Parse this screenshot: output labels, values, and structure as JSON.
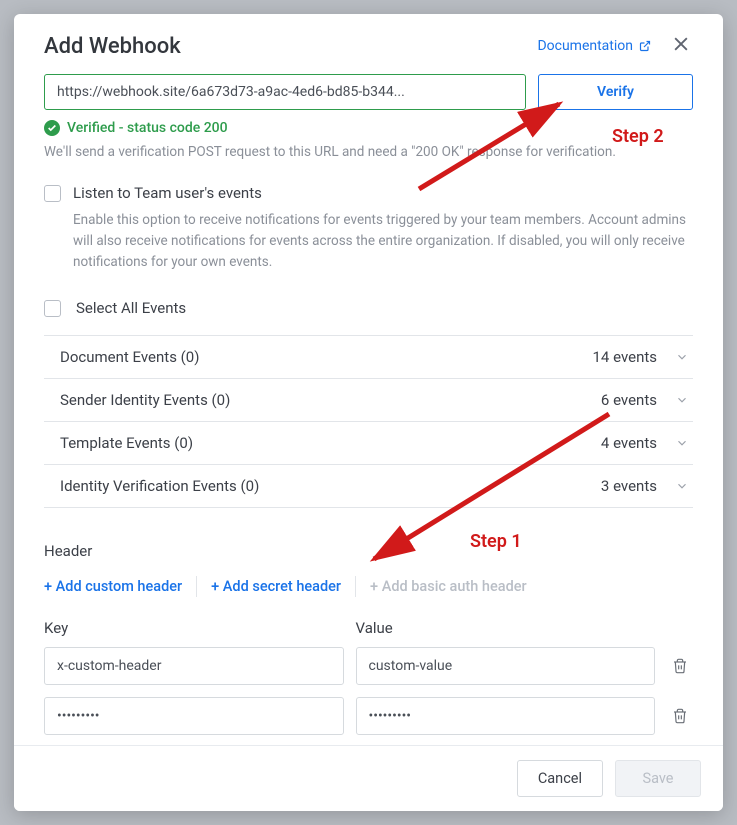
{
  "title": "Add Webhook",
  "documentation_label": "Documentation",
  "url_value": "https://webhook.site/6a673d73-a9ac-4ed6-bd85-b344...",
  "verify_label": "Verify",
  "verified_text": "Verified - status code 200",
  "verify_help": "We'll send a verification POST request to this URL and need a \"200 OK\" response for verification.",
  "team_events": {
    "label": "Listen to Team user's events",
    "desc": "Enable this option to receive notifications for events triggered by your team members. Account admins will also receive notifications for events across the entire organization. If disabled, you will only receive notifications for your own events."
  },
  "select_all_label": "Select All Events",
  "event_categories": [
    {
      "name": "Document Events (0)",
      "count": "14 events"
    },
    {
      "name": "Sender Identity Events (0)",
      "count": "6 events"
    },
    {
      "name": "Template Events (0)",
      "count": "4 events"
    },
    {
      "name": "Identity Verification Events (0)",
      "count": "3 events"
    }
  ],
  "header_section": {
    "label": "Header",
    "add_custom": "+ Add custom header",
    "add_secret": "+ Add secret header",
    "add_basic": "+ Add basic auth header",
    "key_label": "Key",
    "value_label": "Value",
    "rows": [
      {
        "key": "x-custom-header",
        "value": "custom-value",
        "masked": false
      },
      {
        "key": "•••••••••",
        "value": "•••••••••",
        "masked": true
      }
    ]
  },
  "footer": {
    "cancel": "Cancel",
    "save": "Save"
  },
  "annotations": {
    "step1": "Step 1",
    "step2": "Step 2"
  }
}
